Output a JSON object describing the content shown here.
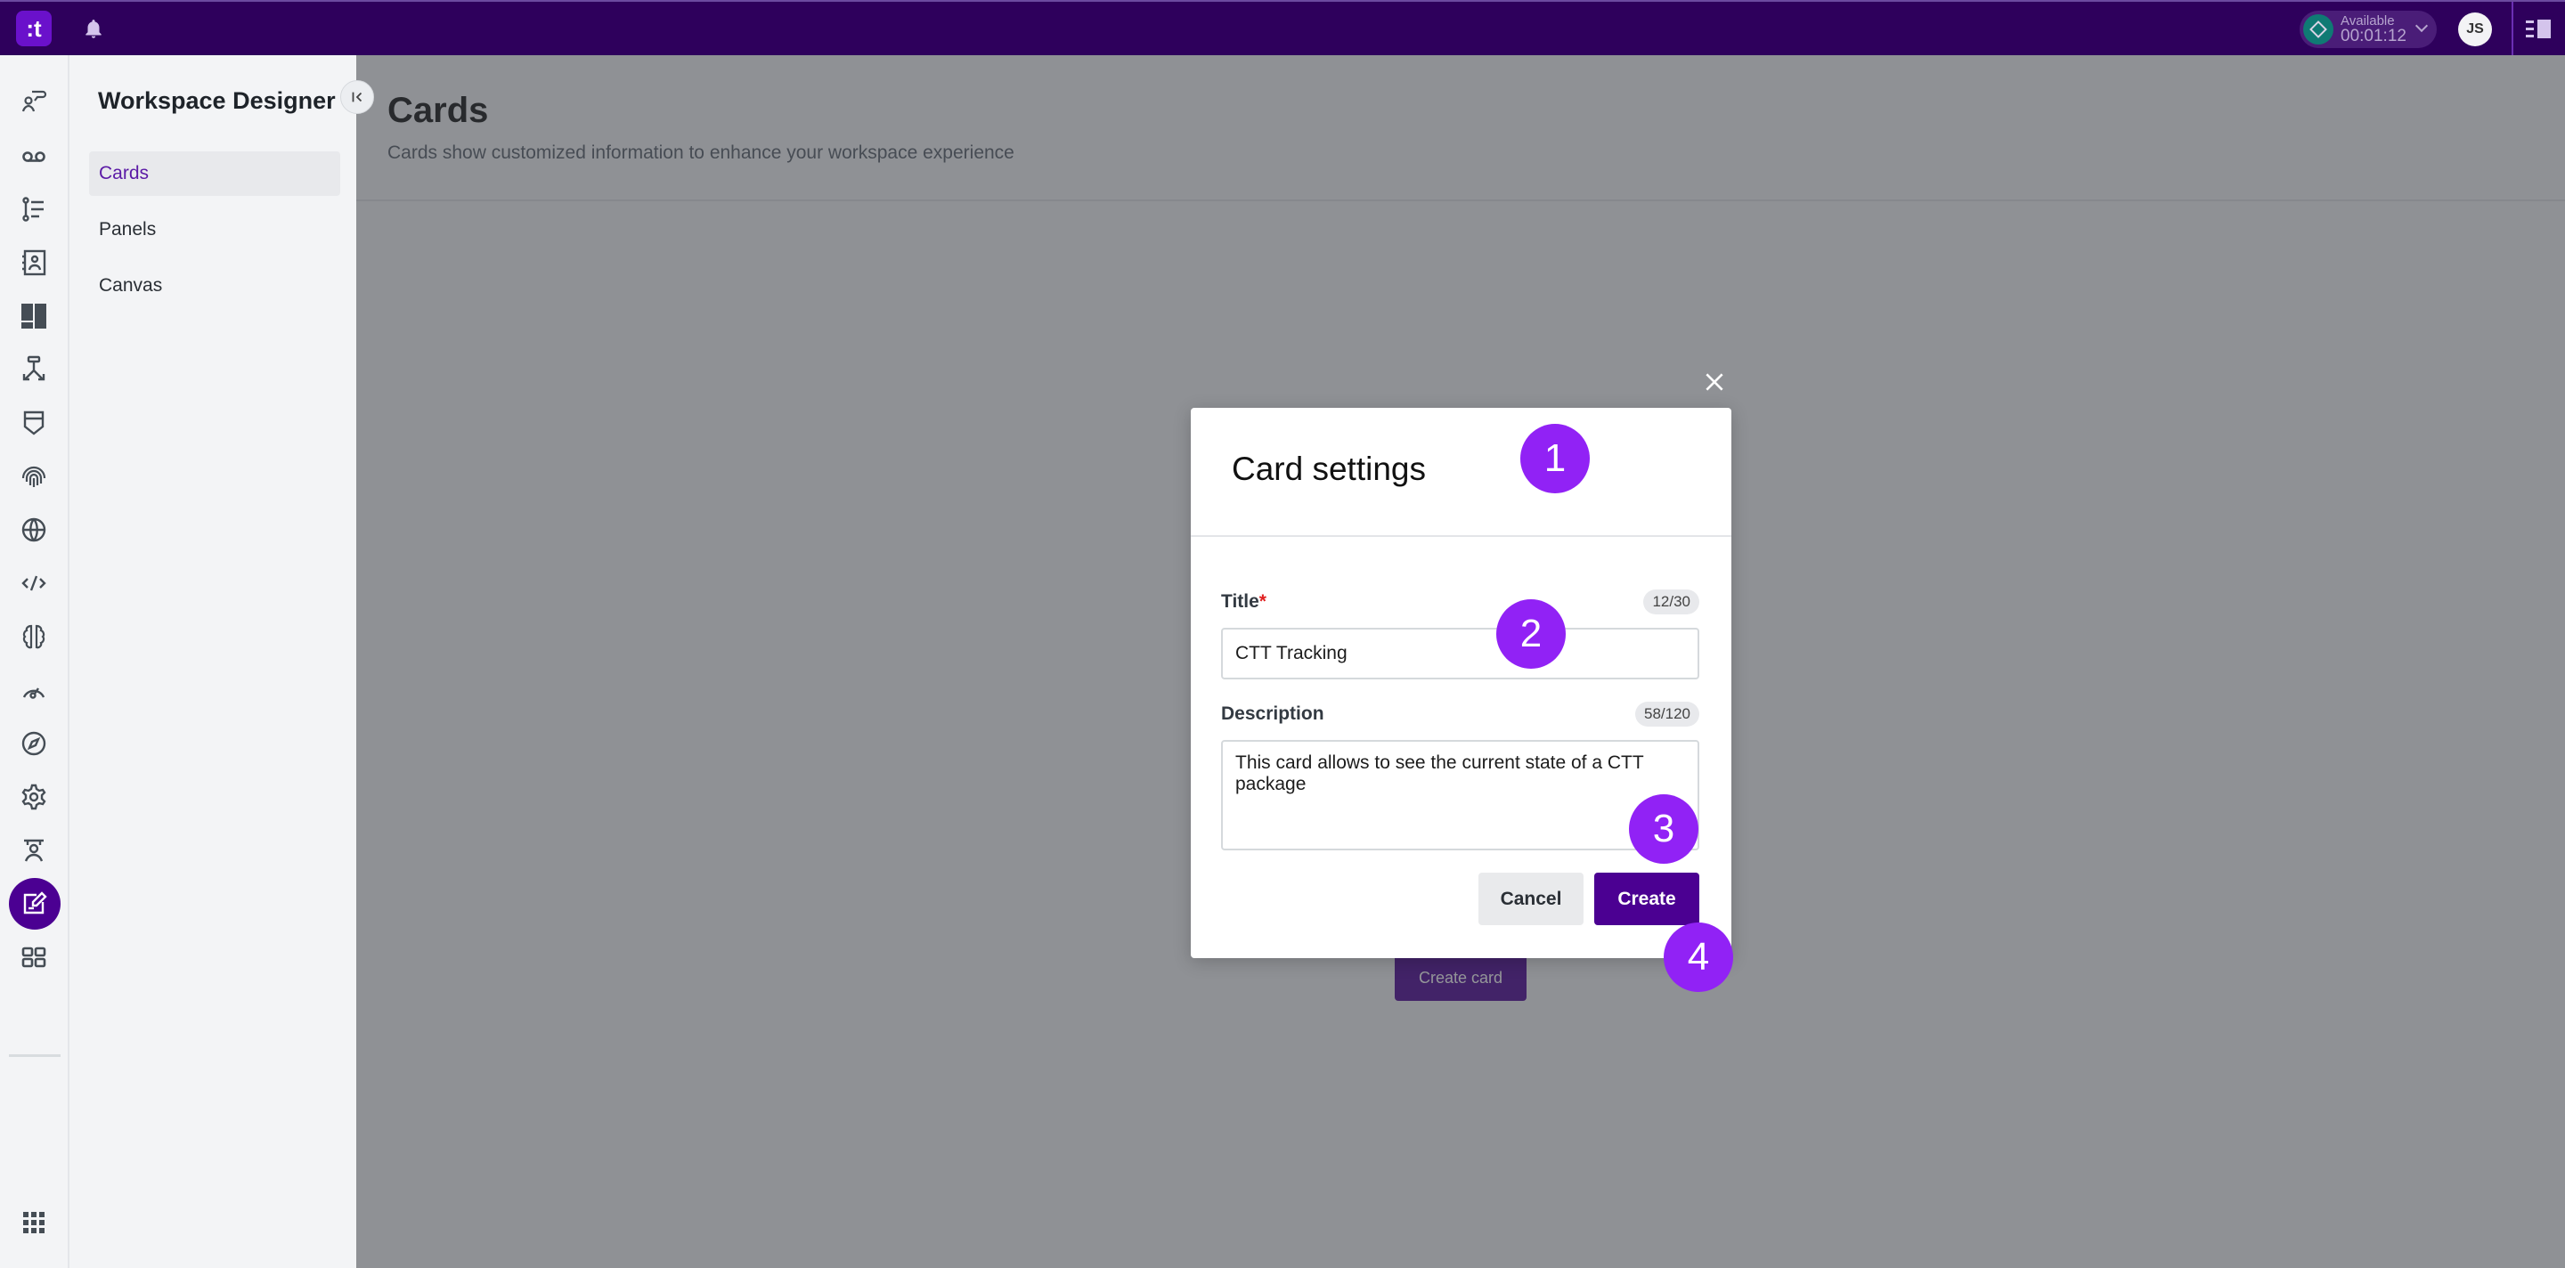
{
  "topbar": {
    "logo_text": ":t",
    "status": {
      "label": "Available",
      "timer": "00:01:12",
      "color": "#0f7a74"
    },
    "user_initials": "JS",
    "brand_color": "#2e005c"
  },
  "rail": {
    "icons": [
      "agent-chat-icon",
      "voicemail-icon",
      "routing-list-icon",
      "contacts-book-icon",
      "layout-icon",
      "flow-icon",
      "shield-icon",
      "fingerprint-icon",
      "globe-icon",
      "code-icon",
      "brain-icon",
      "gauge-icon",
      "compass-icon",
      "gear-icon",
      "supervisor-icon",
      "workspace-designer-icon",
      "grid-icon"
    ],
    "active_index": 15,
    "bottom_icon": "apps-grid-icon"
  },
  "sidebar": {
    "title": "Workspace Designer",
    "items": [
      {
        "label": "Cards",
        "active": true
      },
      {
        "label": "Panels",
        "active": false
      },
      {
        "label": "Canvas",
        "active": false
      }
    ]
  },
  "main": {
    "title": "Cards",
    "subtitle": "Cards show customized information to enhance your workspace experience",
    "create_card_label": "Create card"
  },
  "modal": {
    "title": "Card settings",
    "title_field": {
      "label": "Title",
      "required_mark": "*",
      "counter": "12/30",
      "value": "CTT Tracking"
    },
    "description_field": {
      "label": "Description",
      "counter": "58/120",
      "value": "This card allows to see the current state of a CTT package"
    },
    "cancel_label": "Cancel",
    "create_label": "Create"
  },
  "steps": [
    "1",
    "2",
    "3",
    "4"
  ],
  "accent_color": "#4b0092",
  "step_color": "#9122f5"
}
